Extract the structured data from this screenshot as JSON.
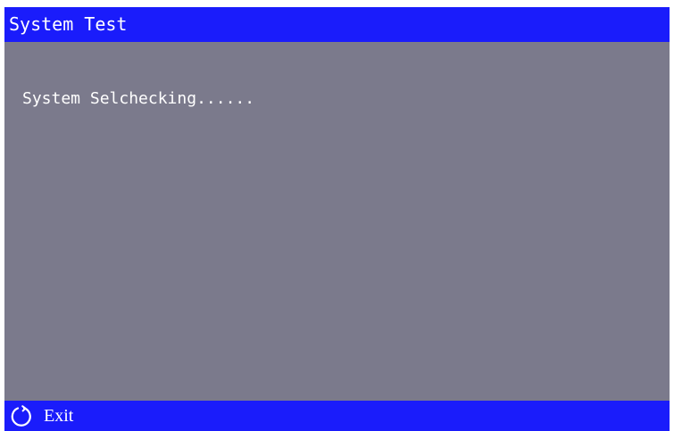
{
  "window": {
    "title": "System Test"
  },
  "main": {
    "status_text": "System Selchecking......"
  },
  "bottom_bar": {
    "exit_label": "Exit",
    "exit_icon": "refresh-icon"
  },
  "colors": {
    "title_bar": "#1a1cfb",
    "background": "#7b7a8c",
    "text": "#ffffff"
  }
}
